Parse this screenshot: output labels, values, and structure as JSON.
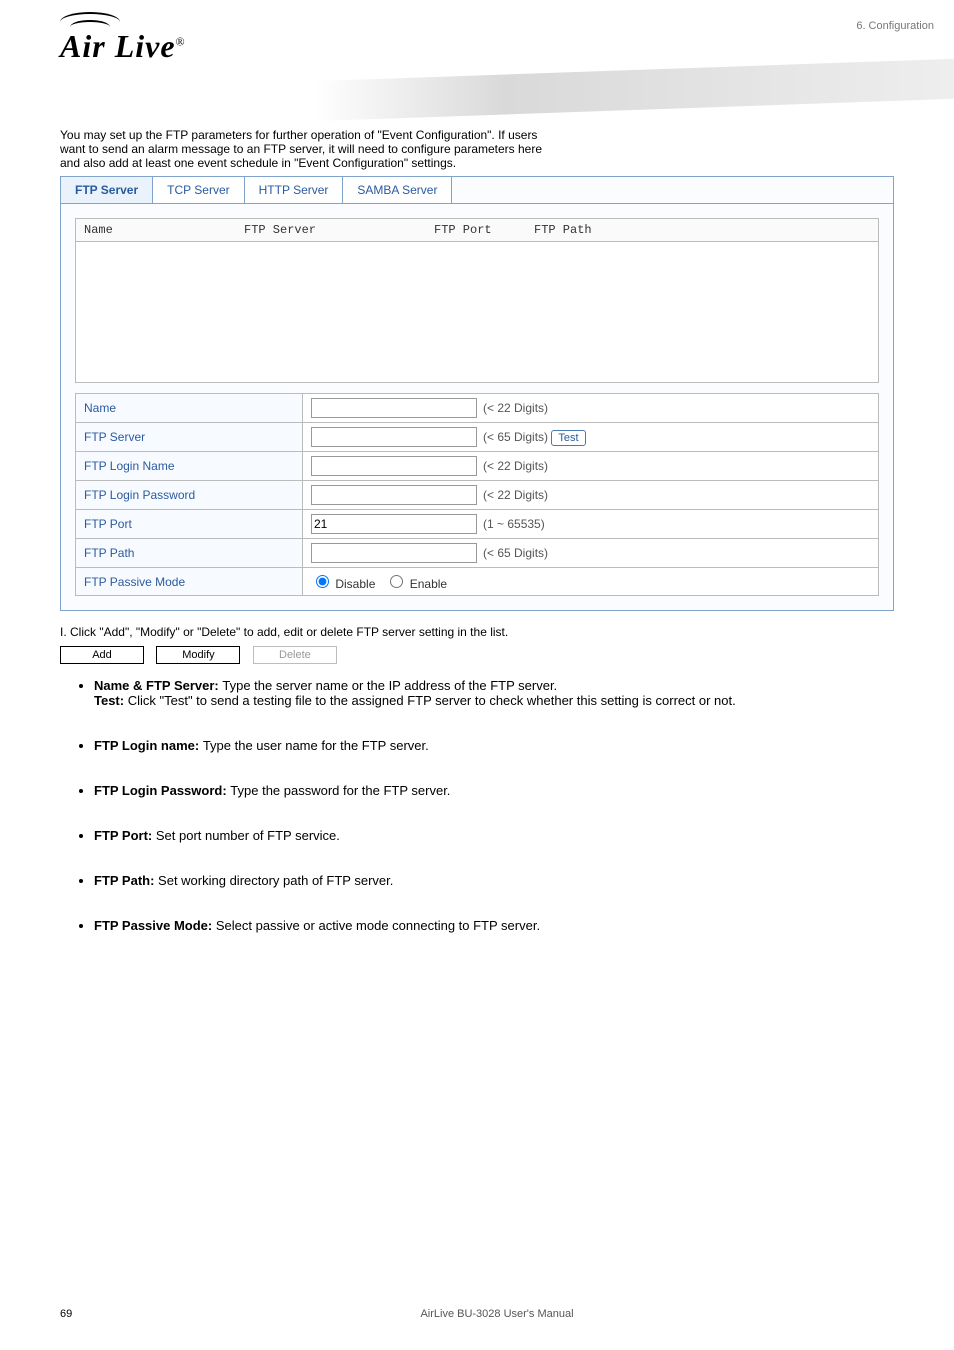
{
  "chapter": "6. Configuration",
  "logo": {
    "text": "Air Live",
    "reg": "®"
  },
  "intro_line1": "You may set up the FTP parameters for further operation of \"Event Configuration\". If users",
  "intro_line2": "want to send an alarm message to an FTP server, it will need to configure parameters here",
  "intro_line3": "and also add at least one event schedule in \"Event Configuration\" settings.",
  "tabs": {
    "ftp": "FTP Server",
    "tcp": "TCP Server",
    "http": "HTTP Server",
    "samba": "SAMBA Server"
  },
  "list_headers": {
    "name": "Name",
    "server": "FTP Server",
    "port": "FTP Port",
    "path": "FTP Path"
  },
  "form": {
    "name_label": "Name",
    "name_hint": "(< 22 Digits)",
    "server_label": "FTP Server",
    "server_hint": "(< 65 Digits)",
    "test": "Test",
    "login_label": "FTP Login Name",
    "login_hint": "(< 22 Digits)",
    "pwd_label": "FTP Login Password",
    "pwd_hint": "(< 22 Digits)",
    "port_label": "FTP Port",
    "port_value": "21",
    "port_hint": "(1 ~ 65535)",
    "path_label": "FTP Path",
    "path_hint": "(< 65 Digits)",
    "passive_label": "FTP Passive Mode",
    "disable": "Disable",
    "enable": "Enable"
  },
  "after_ss": "I. Click \"Add\", \"Modify\" or \"Delete\" to add, edit or delete FTP server setting in the list.",
  "buttons": {
    "add": "Add",
    "modify": "Modify",
    "delete": "Delete"
  },
  "bullets": [
    {
      "title_a": "Name & FTP Server: ",
      "body_a": "Type the server name or the IP address of the FTP server.",
      "title_b": "Test: ",
      "body_b": "Click \"Test\" to send a testing file to the assigned FTP server to check whether this setting is correct or not."
    },
    {
      "title_a": "FTP Login name: ",
      "body_a": "Type the user name for the FTP server.",
      "title_b": "",
      "body_b": ""
    },
    {
      "title_a": "FTP Login Password: ",
      "body_a": "Type the password for the FTP server.",
      "title_b": "",
      "body_b": ""
    },
    {
      "title_a": "FTP Port: ",
      "body_a": "Set port number of FTP service.",
      "title_b": "",
      "body_b": ""
    },
    {
      "title_a": "FTP Path: ",
      "body_a": "Set working directory path of FTP server.",
      "title_b": "",
      "body_b": ""
    },
    {
      "title_a": "FTP Passive Mode: ",
      "body_a": "Select passive or active mode connecting to FTP server.",
      "title_b": "",
      "body_b": ""
    }
  ],
  "footer": {
    "page": "69",
    "text": "AirLive BU-3028 User's Manual"
  }
}
